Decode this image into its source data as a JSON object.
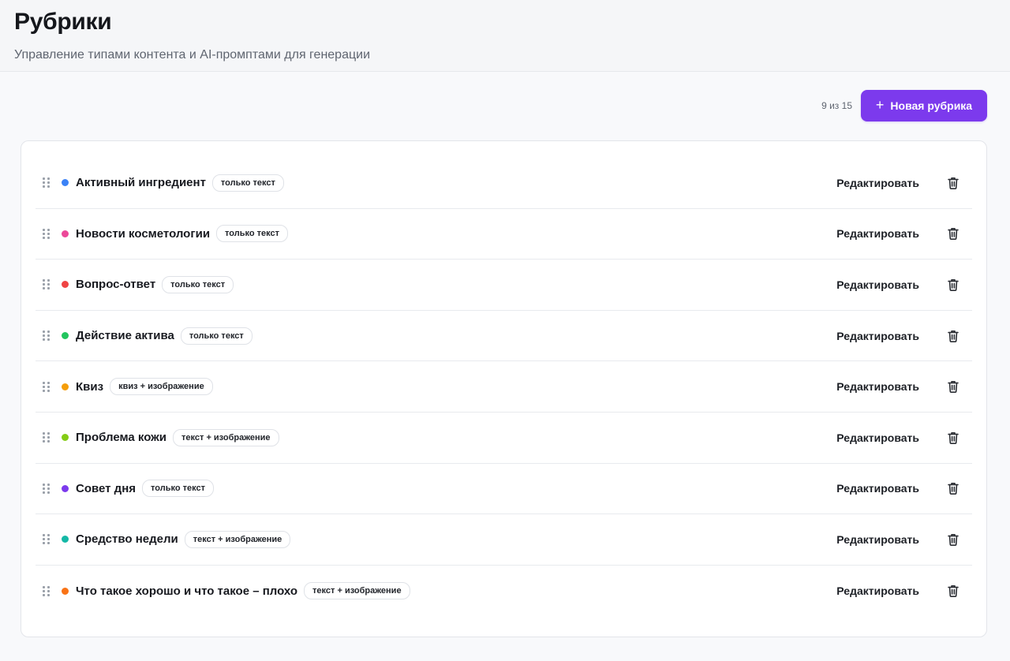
{
  "header": {
    "title": "Рубрики",
    "subtitle": "Управление типами контента и AI-промптами для генерации"
  },
  "toolbar": {
    "counter": "9 из 15",
    "new_label": "Новая рубрика",
    "new_icon": "plus-icon",
    "accent": "#7c3aed"
  },
  "rows": [
    {
      "name": "Активный ингредиент",
      "badge": "только текст",
      "color": "#3b82f6",
      "edit": "Редактировать"
    },
    {
      "name": "Новости косметологии",
      "badge": "только текст",
      "color": "#ec4899",
      "edit": "Редактировать"
    },
    {
      "name": "Вопрос-ответ",
      "badge": "только текст",
      "color": "#ef4444",
      "edit": "Редактировать"
    },
    {
      "name": "Действие актива",
      "badge": "только текст",
      "color": "#22c55e",
      "edit": "Редактировать"
    },
    {
      "name": "Квиз",
      "badge": "квиз + изображение",
      "color": "#f59e0b",
      "edit": "Редактировать"
    },
    {
      "name": "Проблема кожи",
      "badge": "текст + изображение",
      "color": "#84cc16",
      "edit": "Редактировать"
    },
    {
      "name": "Совет дня",
      "badge": "только текст",
      "color": "#7c3aed",
      "edit": "Редактировать"
    },
    {
      "name": "Средство недели",
      "badge": "текст + изображение",
      "color": "#14b8a6",
      "edit": "Редактировать"
    },
    {
      "name": "Что такое хорошо и что такое – плохо",
      "badge": "текст + изображение",
      "color": "#f97316",
      "edit": "Редактировать"
    }
  ]
}
